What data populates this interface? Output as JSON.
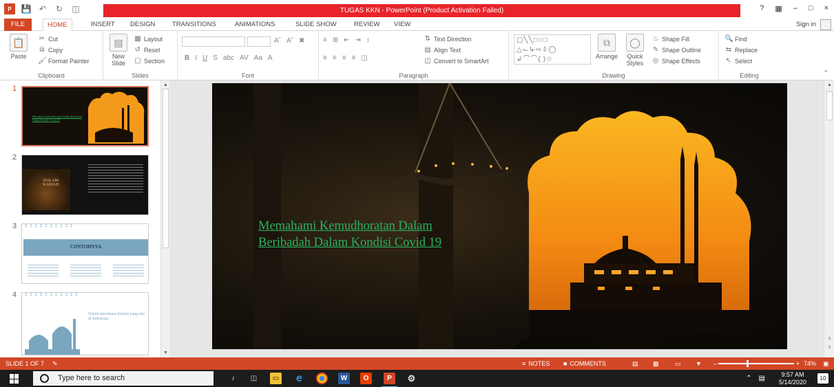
{
  "window": {
    "title": "TUGAS KKN -  PowerPoint (Product Activation Failed)",
    "help": "?",
    "controls": [
      "–",
      "□",
      "×"
    ]
  },
  "tabs": [
    "FILE",
    "HOME",
    "INSERT",
    "DESIGN",
    "TRANSITIONS",
    "ANIMATIONS",
    "SLIDE SHOW",
    "REVIEW",
    "VIEW"
  ],
  "active_tab": "HOME",
  "signin": "Sign in",
  "ribbon": {
    "clipboard": {
      "label": "Clipboard",
      "paste": "Paste",
      "cut": "Cut",
      "copy": "Copy",
      "format_painter": "Format Painter"
    },
    "slides": {
      "label": "Slides",
      "new_slide": "New Slide",
      "layout": "Layout",
      "reset": "Reset",
      "section": "Section"
    },
    "font": {
      "label": "Font"
    },
    "paragraph": {
      "label": "Paragraph",
      "text_direction": "Text Direction",
      "align_text": "Align Text",
      "convert_smartart": "Convert to SmartArt"
    },
    "drawing": {
      "label": "Drawing",
      "arrange": "Arrange",
      "quick_styles": "Quick Styles",
      "shape_fill": "Shape Fill",
      "shape_outline": "Shape Outline",
      "shape_effects": "Shape Effects"
    },
    "editing": {
      "label": "Editing",
      "find": "Find",
      "replace": "Replace",
      "select": "Select"
    }
  },
  "thumbnails": [
    {
      "number": "1",
      "text": "Memahami Kemudhoratan Dalam Beribadah Dalam Kondisi Covid 19"
    },
    {
      "number": "2",
      "text": "DALAM KAIDAH"
    },
    {
      "number": "3",
      "text": "CONTOHNYA"
    },
    {
      "number": "4",
      "text": "Dalam ketentuan hukum yang ada di Indonesia"
    }
  ],
  "slide": {
    "title_line1": "Memahami Kemudhoratan Dalam",
    "title_line2": "Beribadah Dalam Kondisi Covid 19"
  },
  "status": {
    "slide_info": "SLIDE 1 OF 7",
    "notes": "NOTES",
    "comments": "COMMENTS",
    "zoom": "74%",
    "zoom_level": 0.74
  },
  "taskbar": {
    "search_placeholder": "Type here to search",
    "time": "9:57 AM",
    "date": "5/14/2020",
    "notification_count": "10"
  },
  "colors": {
    "accent": "#d24726",
    "title_red": "#e8242a",
    "slide_text": "#29b35e",
    "sky_orange": "#f7a01c"
  }
}
